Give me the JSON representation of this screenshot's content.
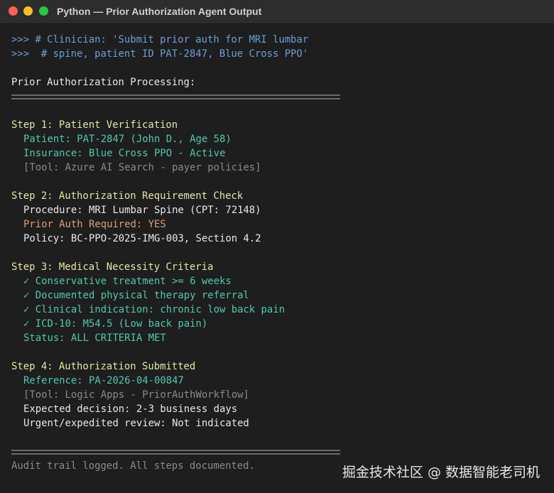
{
  "window": {
    "title": "Python — Prior Authorization Agent Output"
  },
  "prompt": {
    "line1": ">>> # Clinician: 'Submit prior auth for MRI lumbar",
    "line2": ">>>  # spine, patient ID PAT-2847, Blue Cross PPO'"
  },
  "header": "Prior Authorization Processing:",
  "steps": [
    {
      "title": "Step 1: Patient Verification",
      "lines": [
        "Patient: PAT-2847 (John D., Age 58)",
        "Insurance: Blue Cross PPO - Active",
        "[Tool: Azure AI Search - payer policies]"
      ]
    },
    {
      "title": "Step 2: Authorization Requirement Check",
      "lines": [
        "Procedure: MRI Lumbar Spine (CPT: 72148)",
        "Prior Auth Required: YES",
        "Policy: BC-PPO-2025-IMG-003, Section 4.2"
      ]
    },
    {
      "title": "Step 3: Medical Necessity Criteria",
      "lines": [
        "✓ Conservative treatment >= 6 weeks",
        "✓ Documented physical therapy referral",
        "✓ Clinical indication: chronic low back pain",
        "✓ ICD-10: M54.5 (Low back pain)",
        "Status: ALL CRITERIA MET"
      ]
    },
    {
      "title": "Step 4: Authorization Submitted",
      "lines": [
        "Reference: PA-2026-04-00847",
        "[Tool: Logic Apps - PriorAuthWorkflow]",
        "Expected decision: 2-3 business days",
        "Urgent/expedited review: Not indicated"
      ]
    }
  ],
  "footer": "Audit trail logged. All steps documented.",
  "watermark": "掘金技术社区 @ 数据智能老司机",
  "colors": {
    "background": "#1e1e1e",
    "prompt": "#6a9fd8",
    "step_heading": "#e8e4a8",
    "success": "#4fc9b0",
    "tool": "#8a8a8a",
    "warning": "#d9a07b"
  }
}
